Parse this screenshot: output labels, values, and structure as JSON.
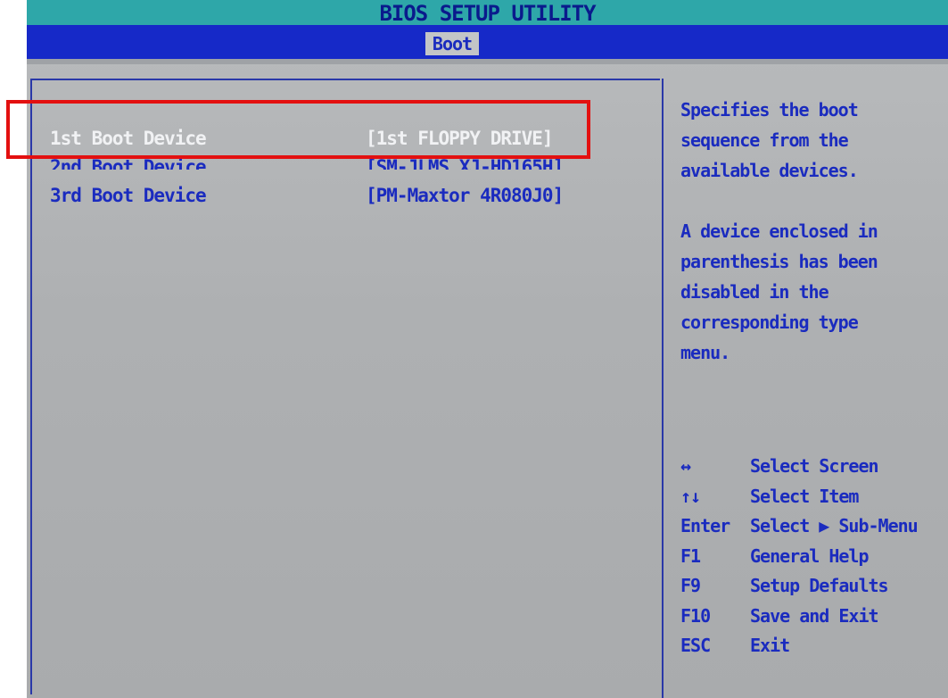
{
  "header": {
    "title": "BIOS SETUP UTILITY"
  },
  "tabs": [
    {
      "label": "Boot",
      "active": true
    }
  ],
  "boot_items": [
    {
      "label": "1st Boot Device",
      "value": "[1st FLOPPY DRIVE]",
      "selected": true
    },
    {
      "label": "2nd Boot Device",
      "value": "[SM-JLMS XJ-HD165H]",
      "selected": false
    },
    {
      "label": "3rd Boot Device",
      "value": "[PM-Maxtor 4R080J0]",
      "selected": false
    }
  ],
  "help": {
    "lines": [
      "Specifies the boot",
      "sequence from the",
      "available devices.",
      "",
      "A device enclosed in",
      "parenthesis has been",
      "disabled in the",
      "corresponding type",
      "menu."
    ]
  },
  "keys": [
    {
      "key": "↔",
      "desc": "Select Screen"
    },
    {
      "key": "↑↓",
      "desc": "Select Item"
    },
    {
      "key": "Enter",
      "desc": "Select ▶ Sub-Menu"
    },
    {
      "key": "F1",
      "desc": "General Help"
    },
    {
      "key": "F9",
      "desc": "Setup Defaults"
    },
    {
      "key": "F10",
      "desc": "Save and Exit"
    },
    {
      "key": "ESC",
      "desc": "Exit"
    }
  ],
  "colors": {
    "title_bar": "#2ea7a9",
    "tab_strip": "#1629c8",
    "text_blue": "#1a2bbf",
    "text_selected": "#f1f2f4",
    "highlight": "#e31010"
  }
}
